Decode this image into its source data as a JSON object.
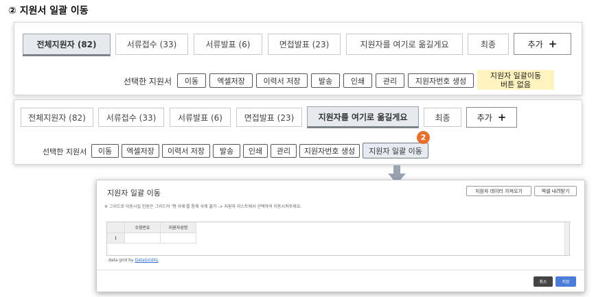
{
  "heading": "② 지원서 일괄 이동",
  "panel1": {
    "tabs": [
      "전체지원자 (82)",
      "서류접수 (33)",
      "서류발표 (6)",
      "면접발표 (23)",
      "지원자를 여기로 옮길게요",
      "최종"
    ],
    "add_label": "추가",
    "add_icon": "+",
    "selected_label": "선택한 지원서",
    "actions": [
      "이동",
      "엑셀저장",
      "이력서 저장",
      "발송",
      "인쇄",
      "관리",
      "지원자번호 생성"
    ],
    "note_line1": "지원자 일괄이동",
    "note_line2": "버튼 없음"
  },
  "panel2": {
    "tabs": [
      "전체지원자 (82)",
      "서류접수 (33)",
      "서류발표 (6)",
      "면접발표 (23)",
      "지원자를 여기로 옮길게요",
      "최종"
    ],
    "add_label": "추가",
    "add_icon": "+",
    "selected_label": "선택한 지원서",
    "actions": [
      "이동",
      "엑셀저장",
      "이력서 저장",
      "발송",
      "인쇄",
      "관리",
      "지원자번호 생성",
      "지원자 일괄 이동"
    ],
    "badge": "2"
  },
  "modal": {
    "title": "지원자 일괄 이동",
    "import_button": "지원자 데이터 가져오기",
    "excel_button": "엑셀 내려받기",
    "hint": "※ 그리드로 이동시킬 인원은 그리드의 '행 삭제'를 통해 삭제 불가 -> 지원자 리스트에서 선택하여 이동시켜주세요.",
    "columns": [
      "수험번호",
      "지원자성명"
    ],
    "row_number": "1",
    "credit_prefix": "data grid by ",
    "credit_link": "DataGridXL",
    "cancel_label": "취소",
    "save_label": "저장"
  },
  "colors": {
    "badge": "#e8702a",
    "note_bg": "#fff3c0",
    "save_button": "#4a7cd8",
    "cancel_button": "#444444"
  },
  "icons": {
    "arrow": "down-arrow-icon",
    "plus": "plus-icon"
  }
}
